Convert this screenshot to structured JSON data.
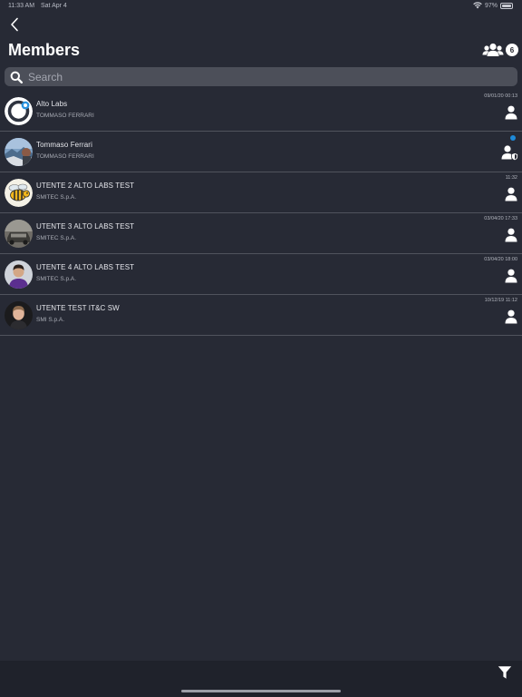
{
  "status_bar": {
    "time": "11:33 AM",
    "date": "Sat Apr 4",
    "battery": "97%",
    "battery_level": 0.97
  },
  "header": {
    "title": "Members",
    "member_count": "6"
  },
  "search": {
    "placeholder": "Search",
    "value": ""
  },
  "members": [
    {
      "name": "Alto Labs",
      "company": "TOMMASO FERRARI",
      "time": "09/01/20 00:13",
      "role_icon": "user-icon",
      "online": false,
      "avatar": "alto-logo"
    },
    {
      "name": "Tommaso Ferrari",
      "company": "TOMMASO FERRARI",
      "time": "",
      "role_icon": "user-admin-icon",
      "online": true,
      "avatar": "photo-landscape"
    },
    {
      "name": "UTENTE 2 ALTO LABS TEST",
      "company": "SMITEC S.p.A.",
      "time": "11:32",
      "role_icon": "user-icon",
      "online": false,
      "avatar": "bee-cartoon"
    },
    {
      "name": "UTENTE 3 ALTO LABS TEST",
      "company": "SMITEC S.p.A.",
      "time": "03/04/20 17:33",
      "role_icon": "user-icon",
      "online": false,
      "avatar": "photo-car"
    },
    {
      "name": "UTENTE 4 ALTO LABS TEST",
      "company": "SMITEC S.p.A.",
      "time": "03/04/20 18:00",
      "role_icon": "user-icon",
      "online": false,
      "avatar": "photo-person-purple"
    },
    {
      "name": "UTENTE TEST IT&C SW",
      "company": "SMI S.p.A.",
      "time": "10/12/19 11:12",
      "role_icon": "user-icon",
      "online": false,
      "avatar": "photo-person-dark"
    }
  ],
  "colors": {
    "background": "#272a35",
    "search_bg": "#4c4f59",
    "divider": "#50535d",
    "online_dot": "#1e8ad8",
    "bottom_bar": "#1f222b"
  }
}
